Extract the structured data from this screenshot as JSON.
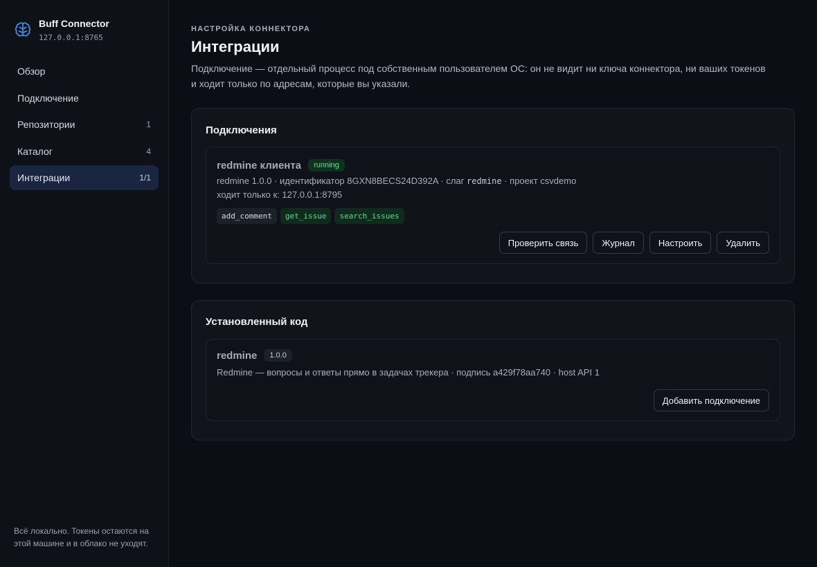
{
  "brand": {
    "name": "Buff Connector",
    "address": "127.0.0.1:8765"
  },
  "nav": [
    {
      "label": "Обзор",
      "count": ""
    },
    {
      "label": "Подключение",
      "count": ""
    },
    {
      "label": "Репозитории",
      "count": "1"
    },
    {
      "label": "Каталог",
      "count": "4"
    },
    {
      "label": "Интеграции",
      "count": "1/1",
      "active": true
    }
  ],
  "sidebar_footer": "Всё локально. Токены остаются на этой машине и в облако не уходят.",
  "header": {
    "eyebrow": "Настройка коннектора",
    "title": "Интеграции",
    "description": "Подключение — отдельный процесс под собственным пользователем ОС: он не видит ни ключа коннектора, ни ваших токенов и ходит только по адресам, которые вы указали."
  },
  "connections": {
    "title": "Подключения",
    "item": {
      "name": "redmine клиента",
      "status": "running",
      "meta_prefix": "redmine 1.0.0 · идентификатор 8GXN8BECS24D392A · слаг ",
      "slug": "redmine",
      "meta_suffix": " · проект csvdemo",
      "hosts": "ходит только к: 127.0.0.1:8795",
      "tools": [
        "add_comment",
        "get_issue",
        "search_issues"
      ],
      "buttons": {
        "check": "Проверить связь",
        "log": "Журнал",
        "configure": "Настроить",
        "delete": "Удалить"
      }
    }
  },
  "installed": {
    "title": "Установленный код",
    "item": {
      "name": "redmine",
      "version": "1.0.0",
      "description": "Redmine — вопросы и ответы прямо в задачах трекера · подпись a429f78aa740 · host API 1",
      "add_button": "Добавить подключение"
    }
  },
  "colors": {
    "accent": "#4a90f0",
    "running": "#5fdb93",
    "active_nav": "#1a2540"
  },
  "icons": {
    "logo": "brain-icon"
  }
}
